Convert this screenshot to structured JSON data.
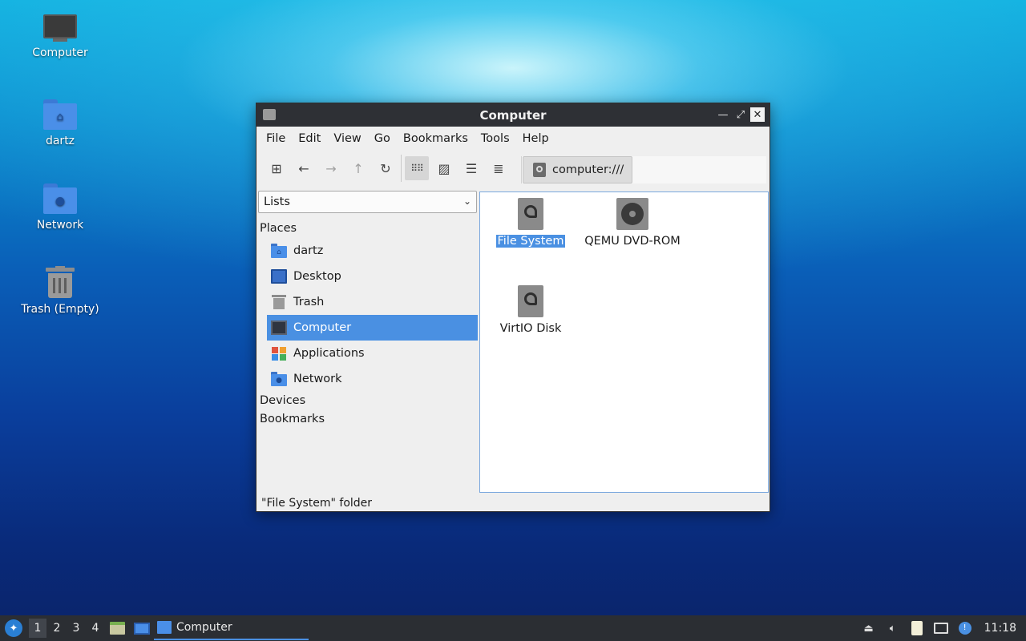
{
  "desktop": {
    "icons": [
      {
        "label": "Computer",
        "icon": "computer-icon"
      },
      {
        "label": "dartz",
        "icon": "home-folder-icon"
      },
      {
        "label": "Network",
        "icon": "network-folder-icon"
      },
      {
        "label": "Trash (Empty)",
        "icon": "trash-icon"
      }
    ]
  },
  "window": {
    "title": "Computer",
    "menu": [
      "File",
      "Edit",
      "View",
      "Go",
      "Bookmarks",
      "Tools",
      "Help"
    ],
    "path": "computer:///",
    "sidebar": {
      "mode": "Lists",
      "places_label": "Places",
      "places": [
        {
          "label": "dartz",
          "icon": "home-folder-icon"
        },
        {
          "label": "Desktop",
          "icon": "desktop-icon"
        },
        {
          "label": "Trash",
          "icon": "trash-icon"
        },
        {
          "label": "Computer",
          "icon": "computer-icon",
          "selected": true
        },
        {
          "label": "Applications",
          "icon": "applications-icon"
        },
        {
          "label": "Network",
          "icon": "network-folder-icon"
        }
      ],
      "devices_label": "Devices",
      "bookmarks_label": "Bookmarks"
    },
    "files": [
      {
        "label": "File System",
        "icon": "harddisk-icon",
        "selected": true
      },
      {
        "label": "QEMU DVD-ROM",
        "icon": "optical-drive-icon"
      },
      {
        "label": "VirtIO Disk",
        "icon": "harddisk-icon"
      }
    ],
    "status": "\"File System\" folder"
  },
  "taskbar": {
    "desktops": [
      "1",
      "2",
      "3",
      "4"
    ],
    "current_desktop": "1",
    "task_label": "Computer",
    "clock": "11:18"
  },
  "colors": {
    "accent": "#4a90e2",
    "titlebar": "#2e3035",
    "taskbar": "#2b2e33"
  }
}
